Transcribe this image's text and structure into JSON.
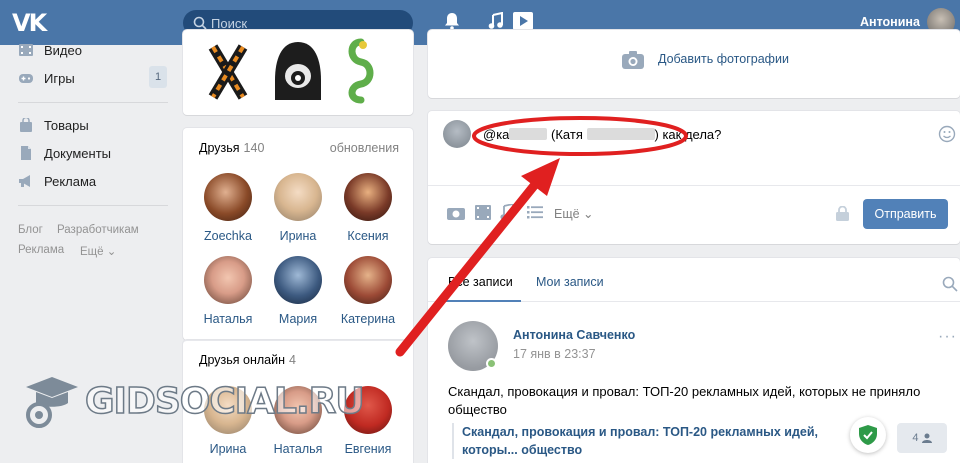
{
  "header": {
    "logo": "VK",
    "search_placeholder": "Поиск",
    "user_name": "Антонина"
  },
  "left_menu": {
    "items": [
      {
        "label": "Видео",
        "icon": "video-icon"
      },
      {
        "label": "Игры",
        "icon": "gamepad-icon",
        "badge": "1"
      },
      {
        "label": "Товары",
        "icon": "bag-icon"
      },
      {
        "label": "Документы",
        "icon": "document-icon"
      },
      {
        "label": "Реклама",
        "icon": "megaphone-icon"
      }
    ],
    "footer_links": [
      "Блог",
      "Разработчикам",
      "Реклама",
      "Ещё"
    ]
  },
  "friends": {
    "title": "Друзья",
    "count": "140",
    "updates": "обновления",
    "list": [
      "Zoechka",
      "Ирина",
      "Ксения",
      "Наталья",
      "Мария",
      "Катерина"
    ]
  },
  "friends_online": {
    "title": "Друзья онлайн",
    "count": "4",
    "list": [
      "Ирина",
      "Наталья",
      "Евгения"
    ]
  },
  "add_photo": {
    "label": "Добавить фотографии"
  },
  "postbox": {
    "text_prefix": "@ка",
    "text_middle": "(Катя",
    "text_suffix": ") как дела?",
    "more_label": "Ещё",
    "send_label": "Отправить"
  },
  "wall": {
    "tabs": [
      "Все записи",
      "Мои записи"
    ],
    "post": {
      "author": "Антонина Савченко",
      "date": "17 янв в 23:37",
      "text": "Скандал, провокация и провал: ТОП-20 рекламных идей, которых не приняло общество",
      "quote": "Скандал, провокация и провал: ТОП-20 рекламных идей, которы... общество",
      "views": "4"
    }
  },
  "watermark": "GIDSOCIAL.RU",
  "colors": {
    "header": "#4a76a8",
    "link": "#2a5885",
    "annotation": "#e02020",
    "button": "#5181b8"
  }
}
